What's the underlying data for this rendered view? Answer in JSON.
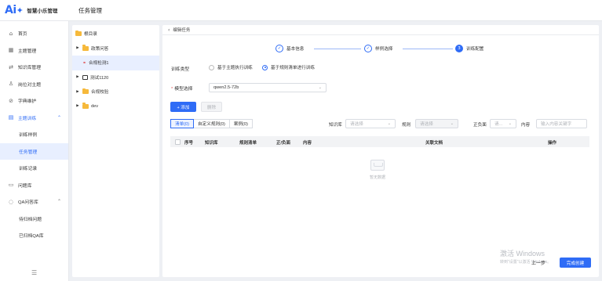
{
  "app": {
    "logo": "Ai",
    "name": "智慧小乐管理",
    "page_title": "任务管理"
  },
  "sidebar": {
    "items": [
      {
        "label": "首页",
        "icon": "home-icon"
      },
      {
        "label": "主题管理",
        "icon": "grid-icon"
      },
      {
        "label": "知识库管理",
        "icon": "swap-icon"
      },
      {
        "label": "岗位对主题",
        "icon": "person-icon"
      },
      {
        "label": "字典维护",
        "icon": "link-icon"
      },
      {
        "label": "主题训练",
        "icon": "book-icon"
      },
      {
        "label": "训练样例"
      },
      {
        "label": "任务管理"
      },
      {
        "label": "训练记录"
      },
      {
        "label": "问题库",
        "icon": "inbox-icon"
      },
      {
        "label": "QA问答库",
        "icon": "chat-icon"
      },
      {
        "label": "待归档问题"
      },
      {
        "label": "已归档QA库"
      }
    ]
  },
  "tree": {
    "root": "根目录",
    "nodes": [
      {
        "label": "政策问答"
      },
      {
        "label": "合规检测1"
      },
      {
        "label": "测试1120"
      },
      {
        "label": "合规校验"
      },
      {
        "label": "dev"
      }
    ]
  },
  "main": {
    "back_label": "编辑任务",
    "steps": [
      {
        "label": "基本信息",
        "mark": "✓"
      },
      {
        "label": "样例选择",
        "mark": "✓"
      },
      {
        "label": "训练配置",
        "mark": "3"
      }
    ],
    "train_type_label": "训练类型",
    "train_type_options": [
      "基于主题执行训练",
      "基于规则清单进行训练"
    ],
    "model_label": "模型选择",
    "model_value": "qwen2.5-72b",
    "add_button": "+ 添加",
    "delete_button": "删除",
    "tabs": [
      "清单(0)",
      "自定义规则(0)",
      "案例(0)"
    ],
    "filters": {
      "kb_label": "知识库",
      "kb_placeholder": "请选择",
      "rule_label": "规则",
      "rule_placeholder": "请选择",
      "polarity_label": "正负面",
      "polarity_placeholder": "请...",
      "content_label": "内容",
      "content_placeholder": "输入内容关键字"
    },
    "table_headers": [
      "序号",
      "知识库",
      "规则清单",
      "正/负面",
      "内容",
      "关联文档",
      "操作"
    ],
    "empty_text": "暂无数据",
    "prev_button": "上一步",
    "finish_button": "完成创建"
  },
  "watermark": {
    "line1": "激活 Windows",
    "line2": "转到\"设置\"以激活 Windows。"
  },
  "colors": {
    "accent": "#2f6cf6",
    "folder": "#f6b93b"
  }
}
